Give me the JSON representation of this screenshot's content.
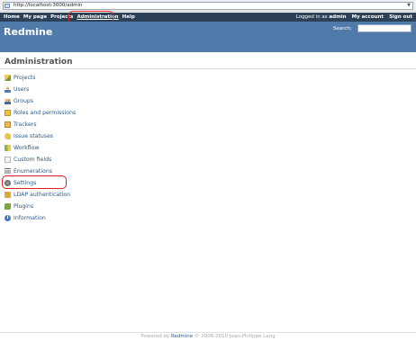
{
  "browser": {
    "url": "http://localhost:3000/admin",
    "dropdown_icon": "chevron-down-icon"
  },
  "topmenu": {
    "items": [
      "Home",
      "My page",
      "Projects",
      "Administration",
      "Help"
    ],
    "logged_in_prefix": "Logged in as",
    "username": "admin",
    "my_account": "My account",
    "sign_out": "Sign out"
  },
  "header": {
    "title": "Redmine",
    "search_label": "Search:",
    "search_value": ""
  },
  "page": {
    "title": "Administration",
    "menu": [
      {
        "label": "Projects",
        "icon": "projects-icon"
      },
      {
        "label": "Users",
        "icon": "users-icon"
      },
      {
        "label": "Groups",
        "icon": "groups-icon"
      },
      {
        "label": "Roles and permissions",
        "icon": "roles-icon"
      },
      {
        "label": "Trackers",
        "icon": "trackers-icon"
      },
      {
        "label": "Issue statuses",
        "icon": "issue-statuses-icon"
      },
      {
        "label": "Workflow",
        "icon": "workflow-icon"
      },
      {
        "label": "Custom fields",
        "icon": "custom-fields-icon"
      },
      {
        "label": "Enumerations",
        "icon": "enumerations-icon"
      },
      {
        "label": "Settings",
        "icon": "settings-icon"
      },
      {
        "label": "LDAP authentication",
        "icon": "ldap-icon"
      },
      {
        "label": "Plugins",
        "icon": "plugins-icon"
      },
      {
        "label": "Information",
        "icon": "information-icon"
      }
    ]
  },
  "footer": {
    "prefix": "Powered by",
    "link": "Redmine",
    "suffix": "© 2006-2010 Jean-Philippe Lang"
  },
  "colors": {
    "topmenu_bg": "#2c4056",
    "header_bg": "#507aaa",
    "link": "#2a5a8a",
    "highlight": "#e0201c"
  }
}
